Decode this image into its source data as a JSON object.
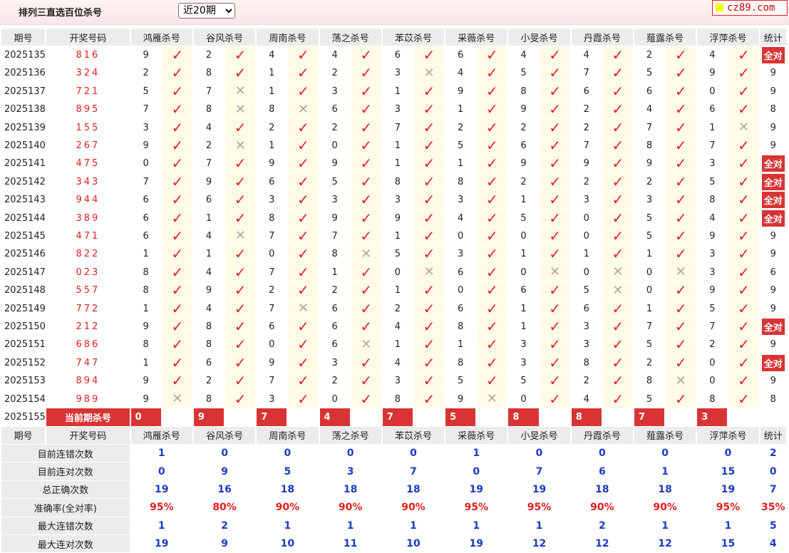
{
  "header": {
    "title": "排列三直选百位杀号",
    "period_selected": "近20期",
    "site_label": "cz89.com"
  },
  "columns": [
    "期号",
    "开奖号码",
    "鸿雁杀号",
    "谷风杀号",
    "周南杀号",
    "荡之杀号",
    "苯苡杀号",
    "采薇杀号",
    "小旻杀号",
    "丹霞杀号",
    "薤露杀号",
    "浮萍杀号",
    "统计"
  ],
  "rows": [
    {
      "period": "2025135",
      "draw": "816",
      "kills": [
        [
          "9",
          "y"
        ],
        [
          "2",
          "y"
        ],
        [
          "4",
          "y"
        ],
        [
          "4",
          "y"
        ],
        [
          "6",
          "y"
        ],
        [
          "6",
          "y"
        ],
        [
          "4",
          "y"
        ],
        [
          "4",
          "y"
        ],
        [
          "2",
          "y"
        ],
        [
          "4",
          "y"
        ]
      ],
      "stat": "全对"
    },
    {
      "period": "2025136",
      "draw": "324",
      "kills": [
        [
          "2",
          "y"
        ],
        [
          "8",
          "y"
        ],
        [
          "1",
          "y"
        ],
        [
          "2",
          "y"
        ],
        [
          "3",
          "n"
        ],
        [
          "4",
          "y"
        ],
        [
          "5",
          "y"
        ],
        [
          "7",
          "y"
        ],
        [
          "5",
          "y"
        ],
        [
          "9",
          "y"
        ]
      ],
      "stat": "9"
    },
    {
      "period": "2025137",
      "draw": "721",
      "kills": [
        [
          "5",
          "y"
        ],
        [
          "7",
          "n"
        ],
        [
          "1",
          "y"
        ],
        [
          "3",
          "y"
        ],
        [
          "1",
          "y"
        ],
        [
          "9",
          "y"
        ],
        [
          "8",
          "y"
        ],
        [
          "6",
          "y"
        ],
        [
          "6",
          "y"
        ],
        [
          "0",
          "y"
        ]
      ],
      "stat": "9"
    },
    {
      "period": "2025138",
      "draw": "895",
      "kills": [
        [
          "7",
          "y"
        ],
        [
          "8",
          "n"
        ],
        [
          "8",
          "n"
        ],
        [
          "6",
          "y"
        ],
        [
          "3",
          "y"
        ],
        [
          "1",
          "y"
        ],
        [
          "9",
          "y"
        ],
        [
          "2",
          "y"
        ],
        [
          "4",
          "y"
        ],
        [
          "6",
          "y"
        ]
      ],
      "stat": "8"
    },
    {
      "period": "2025139",
      "draw": "155",
      "kills": [
        [
          "3",
          "y"
        ],
        [
          "4",
          "y"
        ],
        [
          "2",
          "y"
        ],
        [
          "2",
          "y"
        ],
        [
          "7",
          "y"
        ],
        [
          "2",
          "y"
        ],
        [
          "2",
          "y"
        ],
        [
          "2",
          "y"
        ],
        [
          "7",
          "y"
        ],
        [
          "1",
          "n"
        ]
      ],
      "stat": "9"
    },
    {
      "period": "2025140",
      "draw": "267",
      "kills": [
        [
          "9",
          "y"
        ],
        [
          "2",
          "n"
        ],
        [
          "1",
          "y"
        ],
        [
          "0",
          "y"
        ],
        [
          "1",
          "y"
        ],
        [
          "5",
          "y"
        ],
        [
          "6",
          "y"
        ],
        [
          "7",
          "y"
        ],
        [
          "8",
          "y"
        ],
        [
          "7",
          "y"
        ]
      ],
      "stat": "9"
    },
    {
      "period": "2025141",
      "draw": "475",
      "kills": [
        [
          "0",
          "y"
        ],
        [
          "7",
          "y"
        ],
        [
          "9",
          "y"
        ],
        [
          "9",
          "y"
        ],
        [
          "1",
          "y"
        ],
        [
          "1",
          "y"
        ],
        [
          "9",
          "y"
        ],
        [
          "9",
          "y"
        ],
        [
          "9",
          "y"
        ],
        [
          "3",
          "y"
        ]
      ],
      "stat": "全对"
    },
    {
      "period": "2025142",
      "draw": "343",
      "kills": [
        [
          "7",
          "y"
        ],
        [
          "9",
          "y"
        ],
        [
          "6",
          "y"
        ],
        [
          "5",
          "y"
        ],
        [
          "8",
          "y"
        ],
        [
          "8",
          "y"
        ],
        [
          "2",
          "y"
        ],
        [
          "2",
          "y"
        ],
        [
          "2",
          "y"
        ],
        [
          "5",
          "y"
        ]
      ],
      "stat": "全对"
    },
    {
      "period": "2025143",
      "draw": "944",
      "kills": [
        [
          "6",
          "y"
        ],
        [
          "6",
          "y"
        ],
        [
          "3",
          "y"
        ],
        [
          "3",
          "y"
        ],
        [
          "3",
          "y"
        ],
        [
          "3",
          "y"
        ],
        [
          "1",
          "y"
        ],
        [
          "3",
          "y"
        ],
        [
          "3",
          "y"
        ],
        [
          "8",
          "y"
        ]
      ],
      "stat": "全对"
    },
    {
      "period": "2025144",
      "draw": "389",
      "kills": [
        [
          "6",
          "y"
        ],
        [
          "1",
          "y"
        ],
        [
          "8",
          "y"
        ],
        [
          "9",
          "y"
        ],
        [
          "9",
          "y"
        ],
        [
          "4",
          "y"
        ],
        [
          "5",
          "y"
        ],
        [
          "0",
          "y"
        ],
        [
          "5",
          "y"
        ],
        [
          "4",
          "y"
        ]
      ],
      "stat": "全对"
    },
    {
      "period": "2025145",
      "draw": "471",
      "kills": [
        [
          "6",
          "y"
        ],
        [
          "4",
          "n"
        ],
        [
          "7",
          "y"
        ],
        [
          "7",
          "y"
        ],
        [
          "1",
          "y"
        ],
        [
          "0",
          "y"
        ],
        [
          "0",
          "y"
        ],
        [
          "0",
          "y"
        ],
        [
          "5",
          "y"
        ],
        [
          "9",
          "y"
        ]
      ],
      "stat": "9"
    },
    {
      "period": "2025146",
      "draw": "822",
      "kills": [
        [
          "1",
          "y"
        ],
        [
          "1",
          "y"
        ],
        [
          "0",
          "y"
        ],
        [
          "8",
          "n"
        ],
        [
          "5",
          "y"
        ],
        [
          "3",
          "y"
        ],
        [
          "1",
          "y"
        ],
        [
          "1",
          "y"
        ],
        [
          "1",
          "y"
        ],
        [
          "3",
          "y"
        ]
      ],
      "stat": "9"
    },
    {
      "period": "2025147",
      "draw": "023",
      "kills": [
        [
          "8",
          "y"
        ],
        [
          "4",
          "y"
        ],
        [
          "7",
          "y"
        ],
        [
          "1",
          "y"
        ],
        [
          "0",
          "n"
        ],
        [
          "6",
          "y"
        ],
        [
          "0",
          "n"
        ],
        [
          "0",
          "n"
        ],
        [
          "0",
          "n"
        ],
        [
          "3",
          "y"
        ]
      ],
      "stat": "6"
    },
    {
      "period": "2025148",
      "draw": "557",
      "kills": [
        [
          "8",
          "y"
        ],
        [
          "9",
          "y"
        ],
        [
          "2",
          "y"
        ],
        [
          "2",
          "y"
        ],
        [
          "1",
          "y"
        ],
        [
          "0",
          "y"
        ],
        [
          "6",
          "y"
        ],
        [
          "5",
          "n"
        ],
        [
          "0",
          "y"
        ],
        [
          "9",
          "y"
        ]
      ],
      "stat": "9"
    },
    {
      "period": "2025149",
      "draw": "772",
      "kills": [
        [
          "1",
          "y"
        ],
        [
          "4",
          "y"
        ],
        [
          "7",
          "n"
        ],
        [
          "6",
          "y"
        ],
        [
          "2",
          "y"
        ],
        [
          "6",
          "y"
        ],
        [
          "1",
          "y"
        ],
        [
          "6",
          "y"
        ],
        [
          "1",
          "y"
        ],
        [
          "5",
          "y"
        ]
      ],
      "stat": "9"
    },
    {
      "period": "2025150",
      "draw": "212",
      "kills": [
        [
          "9",
          "y"
        ],
        [
          "8",
          "y"
        ],
        [
          "6",
          "y"
        ],
        [
          "6",
          "y"
        ],
        [
          "4",
          "y"
        ],
        [
          "8",
          "y"
        ],
        [
          "1",
          "y"
        ],
        [
          "3",
          "y"
        ],
        [
          "7",
          "y"
        ],
        [
          "7",
          "y"
        ]
      ],
      "stat": "全对"
    },
    {
      "period": "2025151",
      "draw": "686",
      "kills": [
        [
          "8",
          "y"
        ],
        [
          "8",
          "y"
        ],
        [
          "0",
          "y"
        ],
        [
          "6",
          "n"
        ],
        [
          "1",
          "y"
        ],
        [
          "1",
          "y"
        ],
        [
          "3",
          "y"
        ],
        [
          "3",
          "y"
        ],
        [
          "5",
          "y"
        ],
        [
          "2",
          "y"
        ]
      ],
      "stat": "9"
    },
    {
      "period": "2025152",
      "draw": "747",
      "kills": [
        [
          "1",
          "y"
        ],
        [
          "6",
          "y"
        ],
        [
          "9",
          "y"
        ],
        [
          "3",
          "y"
        ],
        [
          "4",
          "y"
        ],
        [
          "8",
          "y"
        ],
        [
          "3",
          "y"
        ],
        [
          "8",
          "y"
        ],
        [
          "2",
          "y"
        ],
        [
          "0",
          "y"
        ]
      ],
      "stat": "全对"
    },
    {
      "period": "2025153",
      "draw": "894",
      "kills": [
        [
          "9",
          "y"
        ],
        [
          "2",
          "y"
        ],
        [
          "7",
          "y"
        ],
        [
          "2",
          "y"
        ],
        [
          "3",
          "y"
        ],
        [
          "5",
          "y"
        ],
        [
          "5",
          "y"
        ],
        [
          "2",
          "y"
        ],
        [
          "8",
          "n"
        ],
        [
          "0",
          "y"
        ]
      ],
      "stat": "9"
    },
    {
      "period": "2025154",
      "draw": "989",
      "kills": [
        [
          "9",
          "n"
        ],
        [
          "8",
          "y"
        ],
        [
          "3",
          "y"
        ],
        [
          "0",
          "y"
        ],
        [
          "8",
          "y"
        ],
        [
          "9",
          "n"
        ],
        [
          "0",
          "y"
        ],
        [
          "4",
          "y"
        ],
        [
          "5",
          "y"
        ],
        [
          "8",
          "y"
        ]
      ],
      "stat": "8"
    }
  ],
  "current": {
    "period": "2025155",
    "label": "当前期杀号",
    "kills": [
      "0",
      "9",
      "7",
      "4",
      "7",
      "5",
      "8",
      "8",
      "7",
      "3"
    ]
  },
  "stats": [
    {
      "label": "目前连错次数",
      "values": [
        "1",
        "0",
        "0",
        "0",
        "0",
        "1",
        "0",
        "0",
        "0",
        "0",
        "2"
      ],
      "red": false
    },
    {
      "label": "目前连对次数",
      "values": [
        "0",
        "9",
        "5",
        "3",
        "7",
        "0",
        "7",
        "6",
        "1",
        "15",
        "0"
      ],
      "red": false
    },
    {
      "label": "总正确次数",
      "values": [
        "19",
        "16",
        "18",
        "18",
        "18",
        "19",
        "19",
        "18",
        "18",
        "19",
        "7"
      ],
      "red": false
    },
    {
      "label": "准确率(全对率)",
      "values": [
        "95%",
        "80%",
        "90%",
        "90%",
        "90%",
        "95%",
        "95%",
        "90%",
        "90%",
        "95%",
        "35%"
      ],
      "red": true
    },
    {
      "label": "最大连错次数",
      "values": [
        "1",
        "2",
        "1",
        "1",
        "1",
        "1",
        "1",
        "2",
        "1",
        "1",
        "5"
      ],
      "red": false
    },
    {
      "label": "最大连对次数",
      "values": [
        "19",
        "9",
        "10",
        "11",
        "10",
        "19",
        "12",
        "12",
        "12",
        "15",
        "4"
      ],
      "red": false
    }
  ],
  "marks": {
    "right": "✓",
    "wrong": "✕"
  },
  "colors": {
    "accent_red": "#d93434",
    "number_red": "#e02020",
    "stat_blue": "#1a3cc0",
    "header_gray": "#ececec",
    "mark_bg": "#fffbe6"
  }
}
